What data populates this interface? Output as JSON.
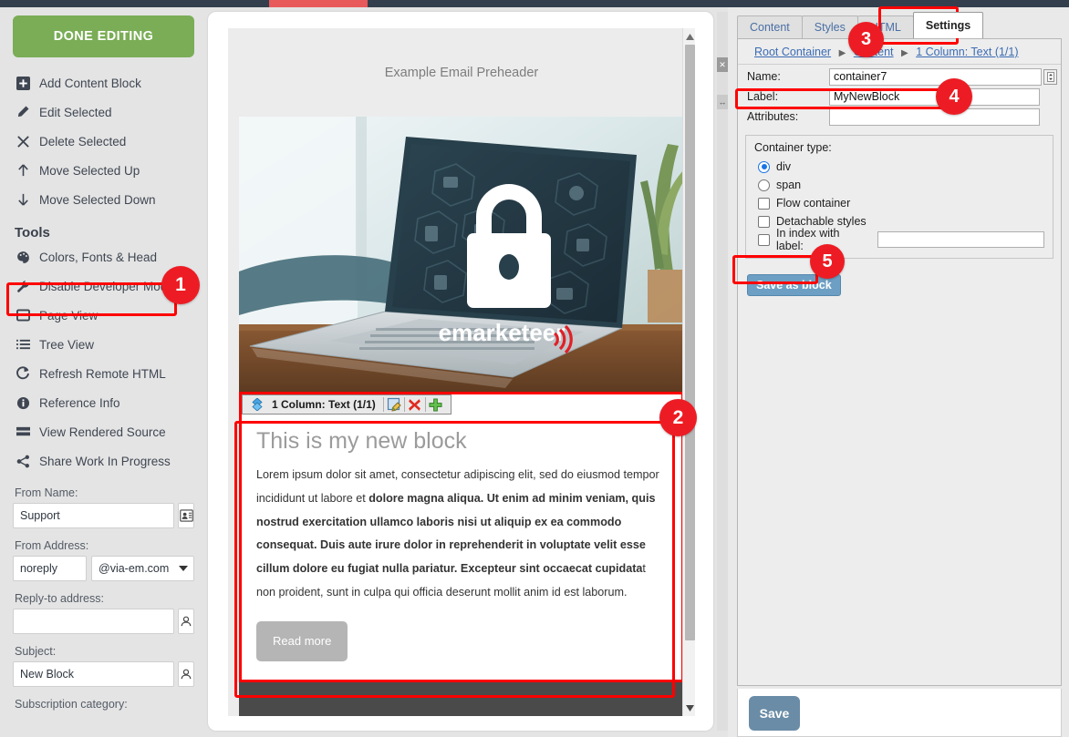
{
  "app": {
    "accent_red": "#ed1c24",
    "green": "#7aad56",
    "blue": "#6d9fc4"
  },
  "sidebar": {
    "done_button": "DONE EDITING",
    "actions": [
      {
        "label": "Add Content Block",
        "icon": "plus-square-icon"
      },
      {
        "label": "Edit Selected",
        "icon": "pencil-icon"
      },
      {
        "label": "Delete Selected",
        "icon": "x-icon"
      },
      {
        "label": "Move Selected Up",
        "icon": "arrow-up-icon"
      },
      {
        "label": "Move Selected Down",
        "icon": "arrow-down-icon"
      }
    ],
    "tools_heading": "Tools",
    "tools": [
      {
        "label": "Colors, Fonts & Head",
        "icon": "palette-icon"
      },
      {
        "label": "Disable Developer Mode",
        "icon": "wrench-icon"
      },
      {
        "label": "Page View",
        "icon": "window-icon"
      },
      {
        "label": "Tree View",
        "icon": "list-icon"
      },
      {
        "label": "Refresh Remote HTML",
        "icon": "refresh-icon"
      },
      {
        "label": "Reference Info",
        "icon": "info-icon"
      },
      {
        "label": "View Rendered Source",
        "icon": "source-icon"
      },
      {
        "label": "Share Work In Progress",
        "icon": "share-icon"
      }
    ],
    "fields": {
      "from_name_label": "From Name:",
      "from_name_value": "Support",
      "from_address_label": "From Address:",
      "from_address_local": "noreply",
      "from_address_domain": "@via-em.com",
      "reply_to_label": "Reply-to address:",
      "reply_to_value": "",
      "subject_label": "Subject:",
      "subject_value": "New Block",
      "subscription_label": "Subscription category:"
    }
  },
  "preview": {
    "preheader": "Example Email Preheader",
    "hero_alt": "laptop-padlock-image",
    "hero_logo": "emarketeer",
    "block_toolbar": {
      "title": "1 Column: Text (1/1)",
      "move_icon": "move-handle-icon",
      "edit_icon": "edit-icon",
      "delete_icon": "delete-icon",
      "add_icon": "add-icon"
    },
    "block_heading": "This is my new block",
    "block_paragraph_plain_start": "Lorem ipsum dolor sit amet, consectetur adipiscing elit, sed do eiusmod tempor incididunt ut labore et ",
    "block_paragraph_bold": "dolore magna aliqua. Ut enim ad minim veniam, quis nostrud exercitation ullamco laboris nisi ut aliquip ex ea commodo consequat. Duis aute irure dolor in reprehenderit in voluptate velit esse cillum dolore eu fugiat nulla pariatur. Excepteur sint occaecat cupidata",
    "block_paragraph_plain_end": "t non proident, sunt in culpa qui officia deserunt mollit anim id est laborum.",
    "read_more": "Read more"
  },
  "splitter": {
    "close_icon": "close-icon",
    "resize_icon": "resize-horizontal-icon"
  },
  "properties": {
    "tabs": [
      {
        "label": "Content",
        "active": false
      },
      {
        "label": "Styles",
        "active": false
      },
      {
        "label": "HTML",
        "active": false
      },
      {
        "label": "Settings",
        "active": true
      }
    ],
    "breadcrumb": [
      "Root Container",
      "Content",
      "1 Column: Text (1/1)"
    ],
    "breadcrumb_separator": "▶",
    "rows": {
      "name_label": "Name:",
      "name_value": "container7",
      "label_label": "Label:",
      "label_value": "MyNewBlock",
      "attributes_label": "Attributes:",
      "attributes_value": ""
    },
    "container_type": {
      "heading": "Container type:",
      "options": [
        {
          "label": "div",
          "type": "radio",
          "checked": true
        },
        {
          "label": "span",
          "type": "radio",
          "checked": false
        },
        {
          "label": "Flow container",
          "type": "checkbox",
          "checked": false
        },
        {
          "label": "Detachable styles",
          "type": "checkbox",
          "checked": false
        },
        {
          "label": "In index with label:",
          "type": "checkbox",
          "checked": false,
          "has_input": true,
          "input_value": ""
        }
      ]
    },
    "save_as_block": "Save as block",
    "save": "Save"
  },
  "annotations": [
    {
      "number": "1",
      "target": "disable-developer-mode"
    },
    {
      "number": "2",
      "target": "selected-text-block"
    },
    {
      "number": "3",
      "target": "settings-tab"
    },
    {
      "number": "4",
      "target": "label-field"
    },
    {
      "number": "5",
      "target": "save-as-block-button"
    }
  ]
}
